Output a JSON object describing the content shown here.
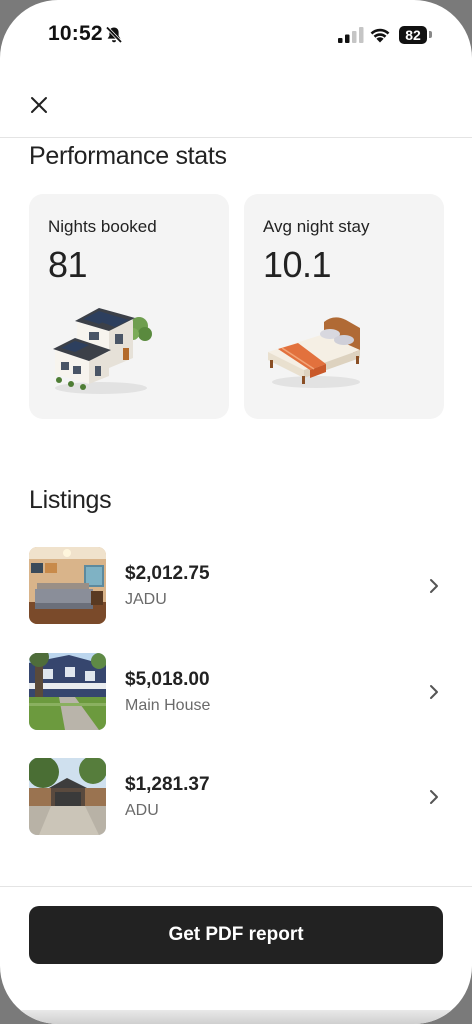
{
  "status_bar": {
    "time": "10:52",
    "battery": "82",
    "icons": [
      "bell-slash-icon",
      "cellular-signal-icon",
      "wifi-icon",
      "battery-icon"
    ]
  },
  "nav": {
    "close_icon": "close-icon"
  },
  "performance": {
    "title": "Performance stats",
    "cards": [
      {
        "label": "Nights booked",
        "value": "81",
        "illustration": "house-illustration"
      },
      {
        "label": "Avg night stay",
        "value": "10.1",
        "illustration": "bed-illustration"
      }
    ]
  },
  "listings": {
    "title": "Listings",
    "items": [
      {
        "price": "$2,012.75",
        "name": "JADU",
        "thumbnail": "bedroom-photo"
      },
      {
        "price": "$5,018.00",
        "name": "Main House",
        "thumbnail": "house-exterior-photo"
      },
      {
        "price": "$1,281.37",
        "name": "ADU",
        "thumbnail": "garage-photo"
      }
    ]
  },
  "footer": {
    "button_label": "Get PDF report"
  },
  "colors": {
    "text_primary": "#222222",
    "text_secondary": "#6a6a6a",
    "card_bg": "#f4f4f4",
    "button_bg": "#222222"
  }
}
